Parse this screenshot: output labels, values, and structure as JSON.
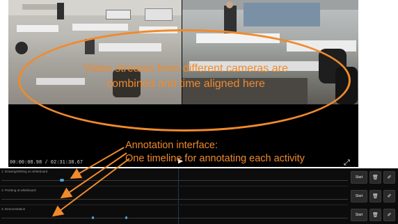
{
  "overlay": {
    "video_caption_line1": "Video streams from different cameras are",
    "video_caption_line2": "combined and time aligned here",
    "annotation_caption_line1": "Annotation interface:",
    "annotation_caption_line2": "One timeline for annotating each activity",
    "accent_color": "#f08a2c"
  },
  "player": {
    "timecode": "00:00:08.98 / 02:31:38.67",
    "play_icon": "▶",
    "fullscreen_icon": "⤢"
  },
  "timelines": [
    {
      "label": "1: Drawing/Writing on whiteboard",
      "start_label": "Start",
      "delete_icon": "🗑",
      "edit_icon": "✐"
    },
    {
      "label": "2: Pointing at whiteboard",
      "start_label": "Start",
      "delete_icon": "🗑",
      "edit_icon": "✐"
    },
    {
      "label": "3: Demonstration",
      "start_label": "Start",
      "delete_icon": "🗑",
      "edit_icon": "✐"
    }
  ]
}
